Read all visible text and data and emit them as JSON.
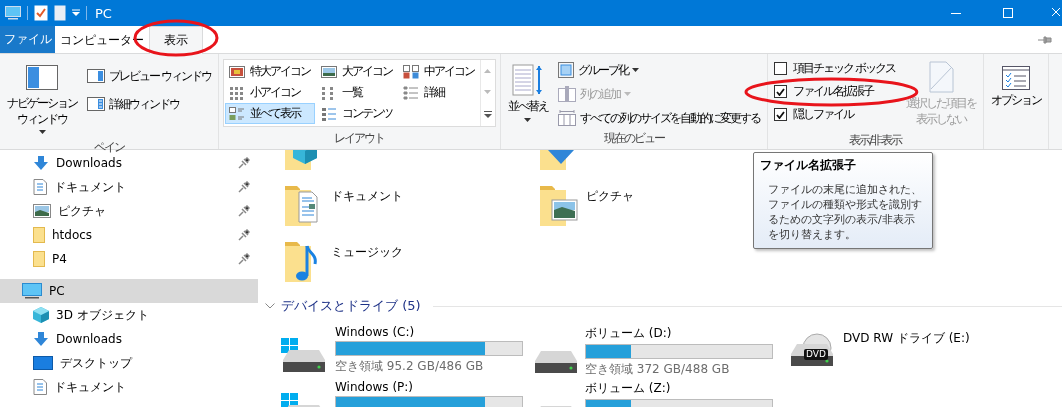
{
  "title_bar": {
    "title": "PC"
  },
  "tabs": [
    {
      "label": "ファイル",
      "kind": "file",
      "selected": false
    },
    {
      "label": "コンピューター",
      "kind": "tab",
      "selected": false
    },
    {
      "label": "表示",
      "kind": "tab",
      "selected": true
    }
  ],
  "ribbon": {
    "pane": {
      "label": "ペイン",
      "navigation_pane": [
        "ナビゲーション",
        "ウィンドウ"
      ],
      "items": [
        "プレビュー ウィンドウ",
        "詳細ウィンドウ"
      ]
    },
    "layout": {
      "label": "レイアウト",
      "items": [
        {
          "label": "特大アイコン",
          "selected": false
        },
        {
          "label": "大アイコン",
          "selected": false
        },
        {
          "label": "中アイコン",
          "selected": false
        },
        {
          "label": "小アイコン",
          "selected": false
        },
        {
          "label": "一覧",
          "selected": false
        },
        {
          "label": "詳細",
          "selected": false
        },
        {
          "label": "並べて表示",
          "selected": true
        },
        {
          "label": "コンテンツ",
          "selected": false
        }
      ]
    },
    "current_view": {
      "label": "現在のビュー",
      "sort": "並べ替え",
      "items": [
        {
          "label": "グループ化",
          "disabled": false
        },
        {
          "label": "列の追加",
          "disabled": true
        },
        {
          "label": "すべての列のサイズを自動的に変更する",
          "disabled": false
        }
      ]
    },
    "show_hide": {
      "label": "表示/非表示",
      "checkboxes": [
        {
          "label": "項目チェック ボックス",
          "checked": false
        },
        {
          "label": "ファイル名拡張子",
          "checked": true
        },
        {
          "label": "隠しファイル",
          "checked": true
        }
      ],
      "hide_selected": {
        "lines": [
          "選択した項目を",
          "表示しない"
        ],
        "disabled": true
      }
    },
    "options": {
      "label": "オプション"
    }
  },
  "navigation": {
    "quick_access": [
      {
        "label": "Downloads",
        "kind": "downloads",
        "pinned": true
      },
      {
        "label": "ドキュメント",
        "kind": "documents",
        "pinned": true
      },
      {
        "label": "ピクチャ",
        "kind": "pictures",
        "pinned": true
      },
      {
        "label": "htdocs",
        "kind": "folder",
        "pinned": true
      },
      {
        "label": "P4",
        "kind": "folder",
        "pinned": true
      }
    ],
    "pc": {
      "label": "PC",
      "kind": "pc",
      "selected": true,
      "children": [
        {
          "label": "3D オブジェクト",
          "kind": "objects3d"
        },
        {
          "label": "Downloads",
          "kind": "downloads"
        },
        {
          "label": "デスクトップ",
          "kind": "desktop"
        },
        {
          "label": "ドキュメント",
          "kind": "documents"
        }
      ]
    }
  },
  "folders": [
    {
      "label": "ドキュメント",
      "kind": "documents"
    },
    {
      "label": "ピクチャ",
      "kind": "pictures"
    },
    {
      "label": "ミュージック",
      "kind": "music"
    }
  ],
  "devices": {
    "header": "デバイスとドライブ (5)",
    "expanded": true,
    "drives": [
      {
        "name": "Windows (C:)",
        "kind": "windows",
        "level": 0.8,
        "free": "空き領域 95.2 GB/486 GB"
      },
      {
        "name": "ボリューム (D:)",
        "kind": "disk",
        "level": 0.243,
        "free": "空き領域 372 GB/488 GB"
      },
      {
        "name": "DVD RW ドライブ (E:)",
        "kind": "dvd",
        "icon_label": "DVD"
      },
      {
        "name": "Windows (P:)",
        "kind": "windows",
        "level": 0.8
      },
      {
        "name": "ボリューム (Z:)",
        "kind": "disk",
        "level": 0.243
      }
    ]
  },
  "tooltip": {
    "title": "ファイル名拡張子",
    "text": "ファイルの末尾に追加された、ファイルの種類や形式を識別するための文字列の表示/非表示を切り替えます。"
  }
}
